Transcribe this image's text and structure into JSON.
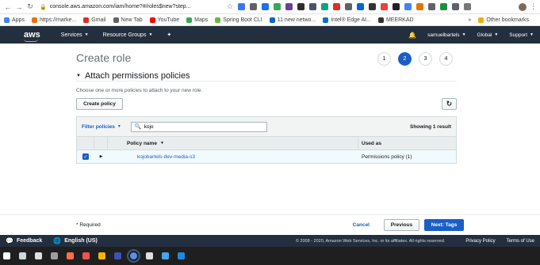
{
  "browser": {
    "url": "console.aws.amazon.com/iam/home?#/roles$new?step...",
    "bookmarks": [
      {
        "label": "Apps",
        "color": "#4285f4"
      },
      {
        "label": "https://marke...",
        "color": "#e8710a"
      },
      {
        "label": "Gmail",
        "color": "#d93025"
      },
      {
        "label": "New Tab",
        "color": "#5f6368"
      },
      {
        "label": "YouTube",
        "color": "#ff0000"
      },
      {
        "label": "Maps",
        "color": "#34a853"
      },
      {
        "label": "Spring Boot CLI",
        "color": "#6db33f"
      },
      {
        "label": "11 new netwo...",
        "color": "#0a66c2"
      },
      {
        "label": "Intel® Edge AI...",
        "color": "#0071c5"
      },
      {
        "label": "MEERKAD",
        "color": "#333333"
      }
    ],
    "other_bookmarks": "Other bookmarks",
    "extension_colors": [
      "#3a76f0",
      "#5f6368",
      "#1a73e8",
      "#34a853",
      "#6b3fa0",
      "#2d2d2d",
      "#4a5568",
      "#10a37f",
      "#d93025",
      "#5f6368",
      "#0a66c2",
      "#333",
      "#ea4335",
      "#202124",
      "#4285f4",
      "#e37400",
      "#5f6368",
      "#1e8e3e",
      "#5f6368",
      "#777"
    ]
  },
  "aws_header": {
    "logo": "aws",
    "services": "Services",
    "resource_groups": "Resource Groups",
    "user": "samuelbartels",
    "region": "Global",
    "support": "Support"
  },
  "page": {
    "title": "Create role",
    "steps": [
      "1",
      "2",
      "3",
      "4"
    ],
    "active_step": "2",
    "section_title": "Attach permissions policies",
    "description": "Choose one or more policies to attach to your new role.",
    "create_policy": "Create policy"
  },
  "table": {
    "filter_label": "Filter policies",
    "search_value": "kojo",
    "showing": "Showing 1 result",
    "columns": {
      "name": "Policy name",
      "used_as": "Used as"
    },
    "rows": [
      {
        "name": "kojobartels-dev-media-s3",
        "used_as": "Permissions policy (1)",
        "checked": true
      }
    ]
  },
  "actions": {
    "required": "* Required",
    "cancel": "Cancel",
    "previous": "Previous",
    "next": "Next: Tags"
  },
  "footer": {
    "feedback": "Feedback",
    "language": "English (US)",
    "copyright": "© 2008 - 2020, Amazon Web Services, Inc. or its affiliates. All rights reserved.",
    "privacy": "Privacy Policy",
    "terms": "Terms of Use"
  },
  "taskbar": {
    "app_colors": [
      "#ffffff",
      "#cfd8dc",
      "#e0e0e0",
      "#9e9e9e",
      "#ff7043",
      "#ef5350",
      "#f4b400",
      "#3f51b5",
      "#5c8ee6",
      "#e0e0e0",
      "#42a5f5",
      "#1e88e5"
    ]
  }
}
